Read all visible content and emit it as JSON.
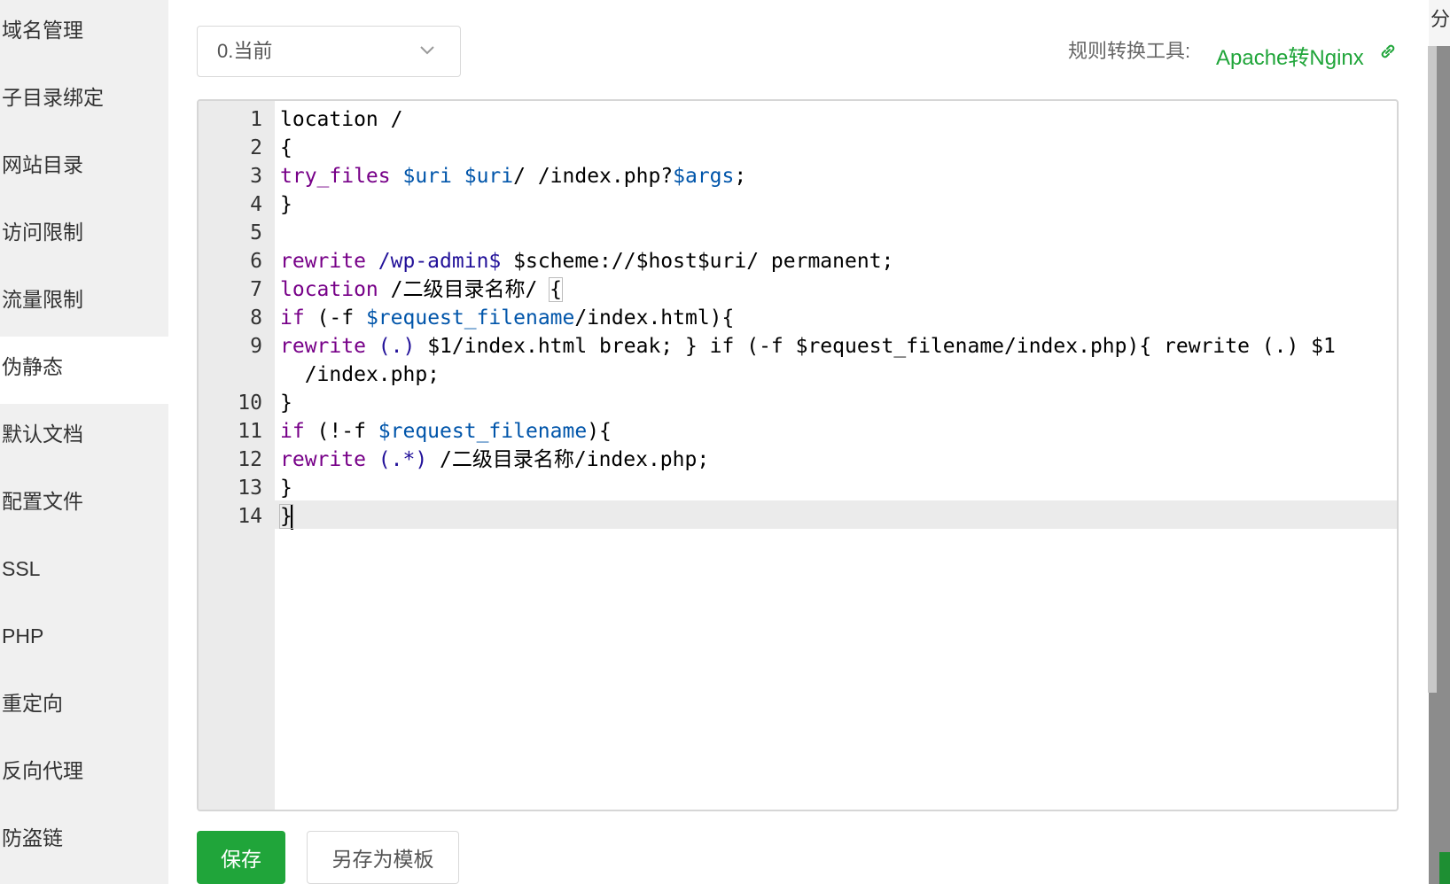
{
  "sidebar": {
    "items": [
      {
        "label": "域名管理"
      },
      {
        "label": "子目录绑定"
      },
      {
        "label": "网站目录"
      },
      {
        "label": "访问限制"
      },
      {
        "label": "流量限制"
      },
      {
        "label": "伪静态"
      },
      {
        "label": "默认文档"
      },
      {
        "label": "配置文件"
      },
      {
        "label": "SSL"
      },
      {
        "label": "PHP"
      },
      {
        "label": "重定向"
      },
      {
        "label": "反向代理"
      },
      {
        "label": "防盗链"
      }
    ],
    "active_index": 5
  },
  "template_select": {
    "selected": "0.当前"
  },
  "converter": {
    "label": "规则转换工具:",
    "link_text": "Apache转Nginx",
    "link_icon": "link-icon"
  },
  "editor": {
    "line_numbers": [
      "1",
      "2",
      "3",
      "4",
      "5",
      "6",
      "7",
      "8",
      "9",
      "10",
      "11",
      "12",
      "13",
      "14"
    ],
    "active_line": 14
  },
  "buttons": {
    "save": "保存",
    "save_as_template": "另存为模板"
  },
  "overlay": {
    "right_edge_text": "分类"
  },
  "colors": {
    "accent_green": "#20a53a",
    "keyword": "#770088",
    "variable": "#0055aa",
    "regex": "#221199"
  }
}
